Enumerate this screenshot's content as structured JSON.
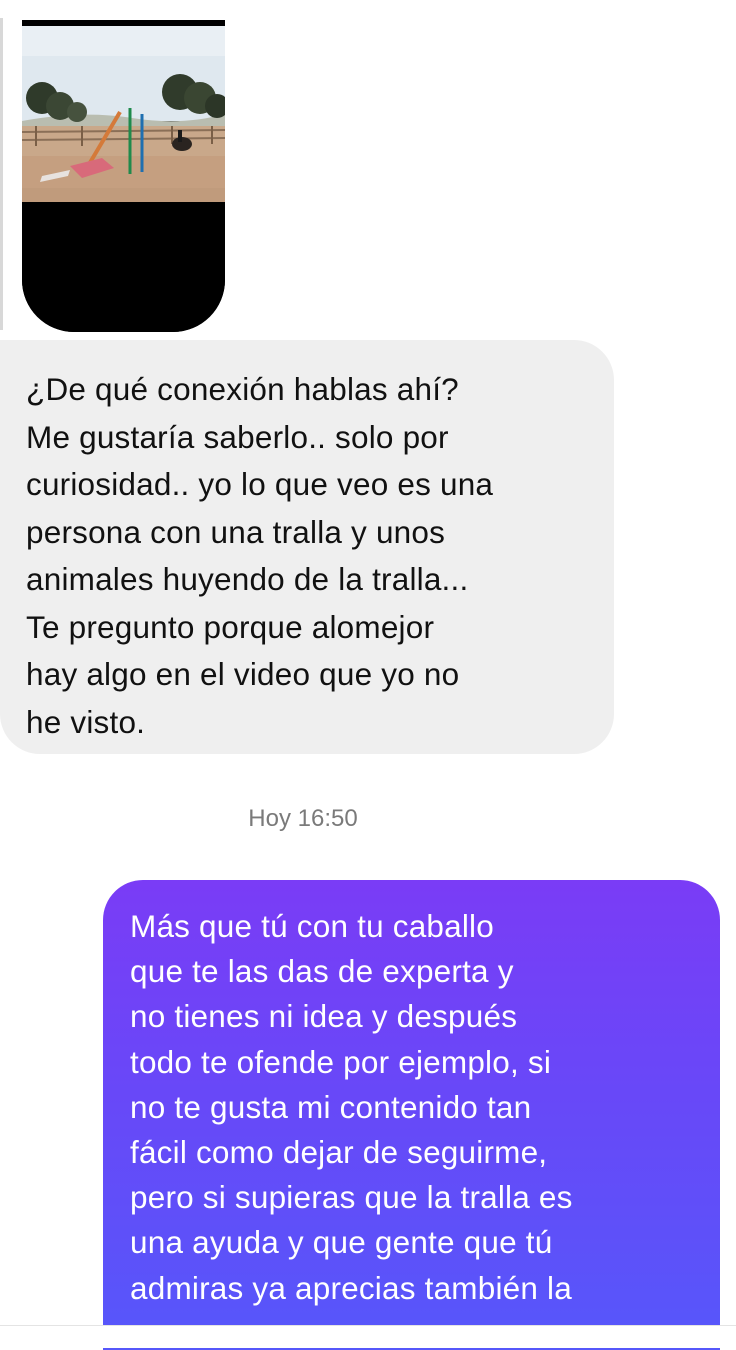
{
  "conversation": {
    "shared_media": {
      "kind": "video",
      "thumbnail_description_icon": "video-thumbnail"
    },
    "received_message": {
      "lines": [
        "¿De qué conexión hablas ahí?",
        "Me gustaría saberlo.. solo por",
        "curiosidad.. yo lo que veo es una",
        "persona con una tralla y unos",
        "animales huyendo de la tralla...",
        "Te pregunto porque alomejor",
        "hay algo en el video que yo no",
        "he visto."
      ]
    },
    "timestamp": "Hoy 16:50",
    "sent_message": {
      "lines": [
        "Más que tú con tu caballo",
        "que te las das de experta y",
        "no tienes ni idea y después",
        "todo te ofende por ejemplo, si",
        "no te gusta mi contenido tan",
        "fácil como dejar de seguirme,",
        "pero si supieras que la tralla es",
        "una ayuda y que gente que tú",
        "admiras ya aprecias también la"
      ]
    }
  },
  "colors": {
    "received_bubble": "#efefef",
    "sent_bubble_top": "#7a3cf6",
    "sent_bubble_bottom": "#5657fa",
    "timestamp": "#7a7a7a"
  }
}
